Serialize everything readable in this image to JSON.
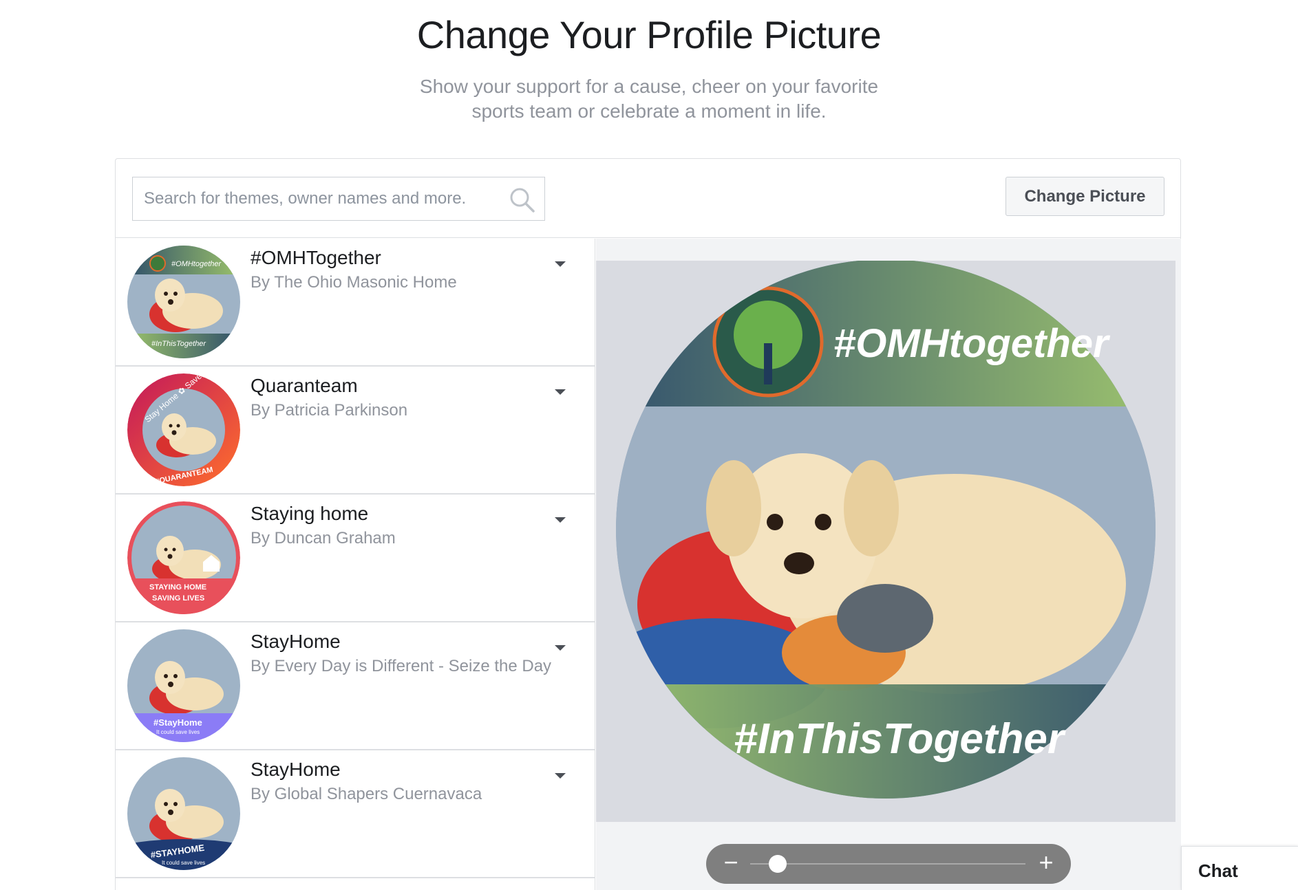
{
  "page": {
    "title": "Change Your Profile Picture",
    "subtitle_line1": "Show your support for a cause, cheer on your favorite",
    "subtitle_line2": "sports team or celebrate a moment in life."
  },
  "search": {
    "placeholder": "Search for themes, owner names and more.",
    "icon": "search-icon"
  },
  "toolbar": {
    "change_picture_label": "Change Picture"
  },
  "frames": [
    {
      "title": "#OMHTogether",
      "owner": "By The Ohio Masonic Home",
      "frame_colors": [
        "#3d5a6b",
        "#9bc26a"
      ],
      "top_text": "#OMHtogether",
      "bottom_text": "#InThisTogether"
    },
    {
      "title": "Quaranteam",
      "owner": "By Patricia Parkinson",
      "frame_colors": [
        "#c2185b",
        "#ff6f2c"
      ],
      "top_text": "Stay Home ✿ Save Lives",
      "bottom_text": "#QUARANTEAM"
    },
    {
      "title": "Staying home",
      "owner": "By Duncan Graham",
      "frame_colors": [
        "#e8505b",
        "#e8505b"
      ],
      "top_text": "STAYING HOME",
      "bottom_text": "SAVING LIVES"
    },
    {
      "title": "StayHome",
      "owner": "By Every Day is Different - Seize the Day",
      "frame_colors": [
        "#8b7cf6",
        "#8b7cf6"
      ],
      "top_text": "#StayHome",
      "bottom_text": "It could save lives"
    },
    {
      "title": "StayHome",
      "owner": "By Global Shapers Cuernavaca",
      "frame_colors": [
        "#1f3b73",
        "#1f3b73"
      ],
      "top_text": "#STAYHOME",
      "bottom_text": "It could save lives"
    }
  ],
  "preview": {
    "top_text": "#OMHtogether",
    "bottom_text": "#InThisTogether",
    "frame_colors": [
      "#2f4f6a",
      "#9bc26a"
    ],
    "zoom_minus": "−",
    "zoom_plus": "+",
    "zoom_level": 0.1
  },
  "chat": {
    "label": "Chat"
  }
}
